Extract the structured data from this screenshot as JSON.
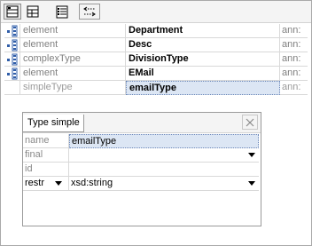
{
  "toolbar": {
    "buttons": [
      {
        "icon": "layout-view-icon",
        "selected": true
      },
      {
        "icon": "grid-view-icon",
        "selected": false
      },
      {
        "icon": "numbered-list-icon",
        "selected": false
      },
      {
        "icon": "swap-arrows-icon",
        "selected": false
      }
    ]
  },
  "elements": [
    {
      "kind": "element",
      "name": "Department",
      "ann": "ann:"
    },
    {
      "kind": "element",
      "name": "Desc",
      "ann": "ann:"
    },
    {
      "kind": "complexType",
      "name": "DivisionType",
      "ann": "ann:"
    },
    {
      "kind": "element",
      "name": "EMail",
      "ann": "ann:"
    },
    {
      "kind": "simpleType",
      "name": "emailType",
      "ann": "ann:"
    }
  ],
  "panel": {
    "rows": {
      "name": {
        "label": "name",
        "value": "emailType"
      },
      "final": {
        "label": "final",
        "value": ""
      },
      "id": {
        "label": "id",
        "value": ""
      },
      "restr": {
        "label": "restr",
        "value": "xsd:string"
      }
    },
    "tab_label": "Type simple"
  }
}
